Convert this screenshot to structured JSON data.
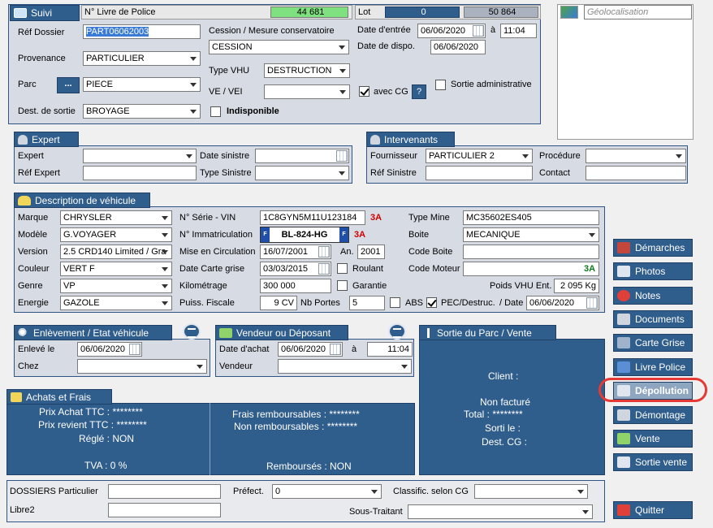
{
  "suivi": {
    "tab": "Suivi",
    "livre_label": "N° Livre de Police",
    "livre_value": "44 681",
    "lot_label": "Lot",
    "lot_value": "0",
    "lot_count": "50 864",
    "ref_dossier_label": "Réf Dossier",
    "ref_dossier": "PART06062003",
    "provenance_label": "Provenance",
    "provenance": "PARTICULIER",
    "parc_label": "Parc",
    "parc_btn": "...",
    "parc": "PIECE",
    "dest_label": "Dest. de sortie",
    "dest": "BROYAGE",
    "cession_label": "Cession / Mesure conservatoire",
    "cession": "CESSION",
    "type_vhu_label": "Type VHU",
    "type_vhu": "DESTRUCTION",
    "ve_vei_label": "VE / VEI",
    "ve_vei": "",
    "avec_cg": "avec CG",
    "help": "?",
    "indisponible": "Indisponible",
    "date_entree_label": "Date d'entrée",
    "date_entree": "06/06/2020",
    "a": "à",
    "heure_entree": "11:04",
    "date_dispo_label": "Date de dispo.",
    "date_dispo": "06/06/2020",
    "sortie_admin": "Sortie administrative",
    "geoloc": "Géolocalisation"
  },
  "expert": {
    "tab": "Expert",
    "expert_label": "Expert",
    "expert": "",
    "ref_expert_label": "Réf Expert",
    "ref_expert": "",
    "date_sinistre_label": "Date sinistre",
    "date_sinistre": "",
    "type_sinistre_label": "Type Sinistre",
    "type_sinistre": ""
  },
  "intervenants": {
    "tab": "Intervenants",
    "fournisseur_label": "Fournisseur",
    "fournisseur": "PARTICULIER 2",
    "ref_sinistre_label": "Réf Sinistre",
    "ref_sinistre": "",
    "procedure_label": "Procédure",
    "procedure": "",
    "contact_label": "Contact",
    "contact": ""
  },
  "vehicule": {
    "tab": "Description de véhicule",
    "marque_label": "Marque",
    "marque": "CHRYSLER",
    "modele_label": "Modèle",
    "modele": "G.VOYAGER",
    "version_label": "Version",
    "version": "2.5 CRD140 Limited / Gra",
    "couleur_label": "Couleur",
    "couleur": "VERT F",
    "genre_label": "Genre",
    "genre": "VP",
    "energie_label": "Energie",
    "energie": "GAZOLE",
    "vin_label": "N° Série - VIN",
    "vin": "1C8GYN5M11U123184",
    "badge_3a": "3A",
    "immat_label": "N° Immatriculation",
    "immat": "BL-824-HG",
    "immat_left": "F",
    "immat_right": "F",
    "mise_circ_label": "Mise en Circulation",
    "mise_circ": "16/07/2001",
    "an_label": "An.",
    "an": "2001",
    "date_cg_label": "Date Carte grise",
    "date_cg": "03/03/2015",
    "roulant": "Roulant",
    "km_label": "Kilométrage",
    "km": "300 000",
    "garantie": "Garantie",
    "puiss_label": "Puiss. Fiscale",
    "puiss": "9 CV",
    "portes_label": "Nb Portes",
    "portes": "5",
    "abs": "ABS",
    "pec": "PEC/Destruc.",
    "pec_date_label": "/ Date",
    "pec_date": "06/06/2020",
    "type_mine_label": "Type Mine",
    "type_mine": "MC35602ES405",
    "boite_label": "Boite",
    "boite": "MECANIQUE",
    "code_boite_label": "Code Boite",
    "code_boite": "",
    "code_moteur_label": "Code Moteur",
    "code_moteur": "",
    "poids_label": "Poids VHU Ent.",
    "poids": "2 095 Kg"
  },
  "enlevement": {
    "tab": "Enlèvement / Etat véhicule",
    "enleve_label": "Enlevé le",
    "enleve": "06/06/2020",
    "chez_label": "Chez",
    "chez": ""
  },
  "vendeur": {
    "tab": "Vendeur ou Déposant",
    "date_achat_label": "Date d'achat",
    "date_achat": "06/06/2020",
    "a": "à",
    "heure": "11:04",
    "vendeur_label": "Vendeur",
    "vendeur": ""
  },
  "sortie_parc": {
    "tab": "Sortie du Parc / Vente",
    "client": "Client :",
    "non_facture": "Non facturé",
    "total": "Total : ********",
    "sorti": "Sorti le :",
    "dest_cg": "Dest. CG :"
  },
  "achats": {
    "tab": "Achats et Frais",
    "prix_achat": "Prix Achat TTC : ********",
    "prix_revient": "Prix revient TTC : ********",
    "regle": "Réglé : NON",
    "tva": "TVA : 0 %",
    "frais_remb": "Frais remboursables : ********",
    "non_remb": "Non remboursables : ********",
    "rembourses": "Remboursés : NON"
  },
  "bottom": {
    "dossiers_label": "DOSSIERS Particulier",
    "dossiers": "",
    "libre2_label": "Libre2",
    "libre2": "",
    "prefect_label": "Préfect.",
    "prefect": "0",
    "classific_label": "Classific. selon CG",
    "classific": "",
    "sous_traitant_label": "Sous-Traitant",
    "sous_traitant": ""
  },
  "buttons": {
    "demarches": "Démarches",
    "photos": "Photos",
    "notes": "Notes",
    "documents": "Documents",
    "carte_grise": "Carte Grise",
    "livre_police": "Livre Police",
    "depollution": "Dépollution",
    "demontage": "Démontage",
    "vente": "Vente",
    "sortie_vente": "Sortie vente",
    "quitter": "Quitter"
  },
  "colors": {
    "accent": "#2f5d8c",
    "panel": "#d7dbe3",
    "highlight": "#e53935",
    "livre_green": "#7ee07e"
  }
}
